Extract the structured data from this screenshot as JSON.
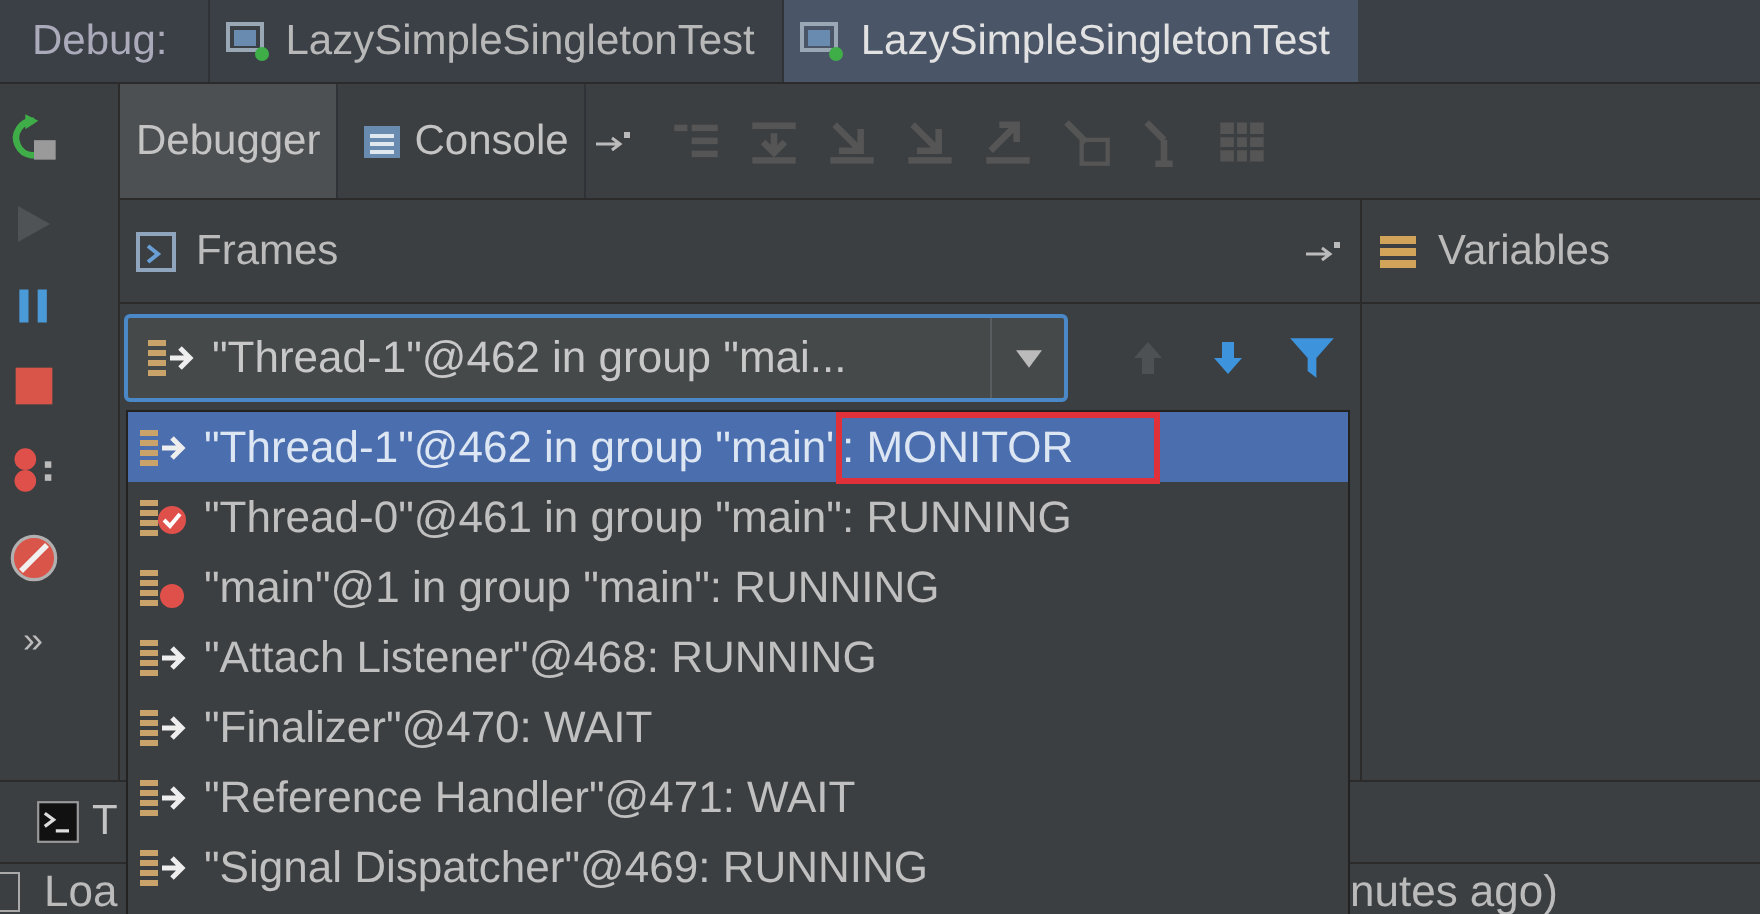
{
  "debug_bar": {
    "label": "Debug:",
    "tabs": [
      {
        "label": "LazySimpleSingletonTest",
        "selected": false
      },
      {
        "label": "LazySimpleSingletonTest",
        "selected": true
      }
    ]
  },
  "toolbar": {
    "tabs": [
      {
        "label": "Debugger",
        "selected": true
      },
      {
        "label": "Console",
        "selected": false
      }
    ]
  },
  "frames": {
    "title": "Frames",
    "thread_selector": "\"Thread-1\"@462 in group \"mai...",
    "threads": [
      {
        "name": "\"Thread-1\"@462 in group \"main\"",
        "status": ": MONITOR",
        "kind": "running",
        "selected": true,
        "boxed": true
      },
      {
        "name": "\"Thread-0\"@461 in group \"main\"",
        "status": ": RUNNING",
        "kind": "breakpoint",
        "selected": false,
        "boxed": false
      },
      {
        "name": "\"main\"@1 in group \"main\"",
        "status": ": RUNNING",
        "kind": "main",
        "selected": false,
        "boxed": false
      },
      {
        "name": "\"Attach Listener\"@468",
        "status": ": RUNNING",
        "kind": "running",
        "selected": false,
        "boxed": false
      },
      {
        "name": "\"Finalizer\"@470",
        "status": ": WAIT",
        "kind": "running",
        "selected": false,
        "boxed": false
      },
      {
        "name": "\"Reference Handler\"@471",
        "status": ": WAIT",
        "kind": "running",
        "selected": false,
        "boxed": false
      },
      {
        "name": "\"Signal Dispatcher\"@469",
        "status": ": RUNNING",
        "kind": "running",
        "selected": false,
        "boxed": false
      }
    ]
  },
  "variables": {
    "title": "Variables"
  },
  "gutter": {
    "more": "»"
  },
  "bottom_tab": {
    "label": "T"
  },
  "status_bar": {
    "left": "Loa",
    "right": "nutes ago)"
  }
}
